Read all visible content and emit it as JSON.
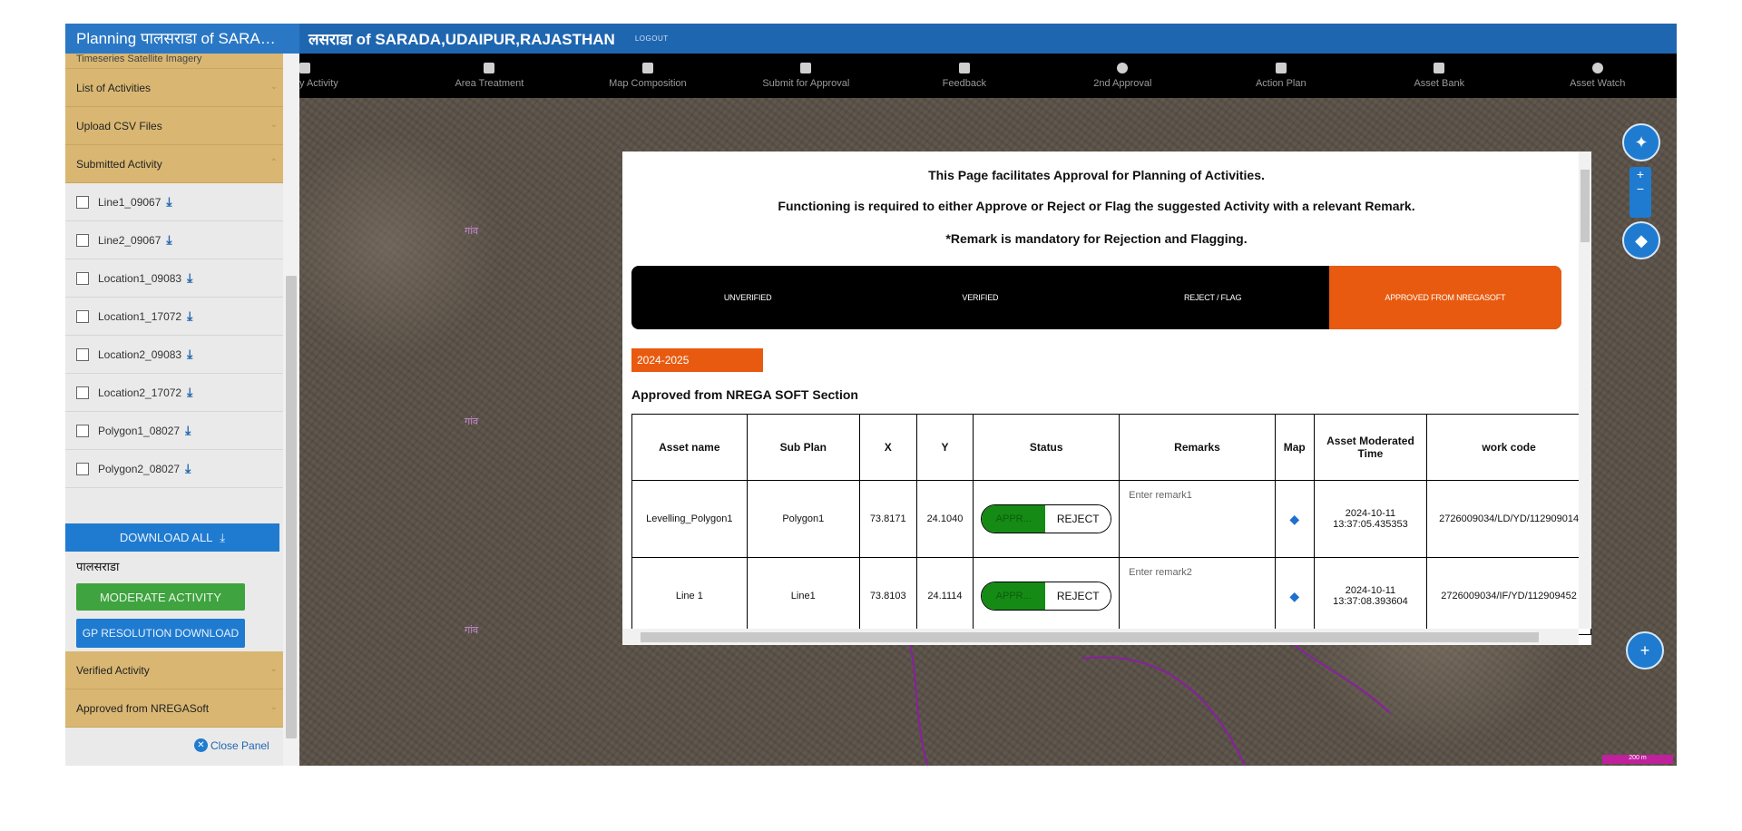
{
  "header": {
    "app_title": "Planning पालसराडा of SARA…",
    "subtitle": "लसराडा of SARADA,UDAIPUR,RAJASTHAN",
    "logout": "LOGOUT"
  },
  "toolbar": {
    "items": [
      "y Activity",
      "Area Treatment",
      "Map Composition",
      "Submit for Approval",
      "Feedback",
      "2nd Approval",
      "Action Plan",
      "Asset Bank",
      "Asset Watch"
    ]
  },
  "sidebar": {
    "top_clipped": "Timeseries Satellite Imagery",
    "sections_top": [
      "List of Activities",
      "Upload CSV Files",
      "Submitted Activity"
    ],
    "files": [
      "Line1_09067",
      "Line2_09067",
      "Location1_09083",
      "Location1_17072",
      "Location2_09083",
      "Location2_17072",
      "Polygon1_08027",
      "Polygon2_08027"
    ],
    "download_all": "DOWNLOAD ALL",
    "gp_name": "पालसराडा",
    "moderate_btn": "MODERATE ACTIVITY",
    "gp_resolution_btn": "GP RESOLUTION DOWNLOAD",
    "sections_bottom": [
      "Verified Activity",
      "Approved from NREGASoft"
    ],
    "close_panel": "Close Panel"
  },
  "modal": {
    "line1": "This Page facilitates Approval for Planning of Activities.",
    "line2": "Functioning is required to either Approve or Reject or Flag the suggested Activity with a relevant Remark.",
    "line3": "*Remark is mandatory for Rejection and Flagging.",
    "tabs": [
      "UNVERIFIED",
      "VERIFIED",
      "REJECT / FLAG",
      "APPROVED FROM NREGASOFT"
    ],
    "year": "2024-2025",
    "section_title": "Approved from NREGA SOFT Section",
    "columns": [
      "Asset name",
      "Sub Plan",
      "X",
      "Y",
      "Status",
      "Remarks",
      "Map",
      "Asset Moderated Time",
      "work code"
    ],
    "rows": [
      {
        "asset": "Levelling_Polygon1",
        "subplan": "Polygon1",
        "x": "73.8171",
        "y": "24.1040",
        "approve": "APPR...",
        "reject": "REJECT",
        "remark_placeholder": "Enter remark1",
        "date": "2024-10-11",
        "time": "13:37:05.435353",
        "workcode": "2726009034/LD/YD/112909014"
      },
      {
        "asset": "Line 1",
        "subplan": "Line1",
        "x": "73.8103",
        "y": "24.1114",
        "approve": "APPR...",
        "reject": "REJECT",
        "remark_placeholder": "Enter remark2",
        "date": "2024-10-11",
        "time": "13:37:08.393604",
        "workcode": "2726009034/IF/YD/112909452"
      }
    ]
  },
  "map": {
    "scale_label": "200 m"
  },
  "colors": {
    "header_blue": "#1f66b0",
    "accordion": "#d9b772",
    "active_tab": "#e85a0f",
    "approve_green": "#158a15"
  }
}
